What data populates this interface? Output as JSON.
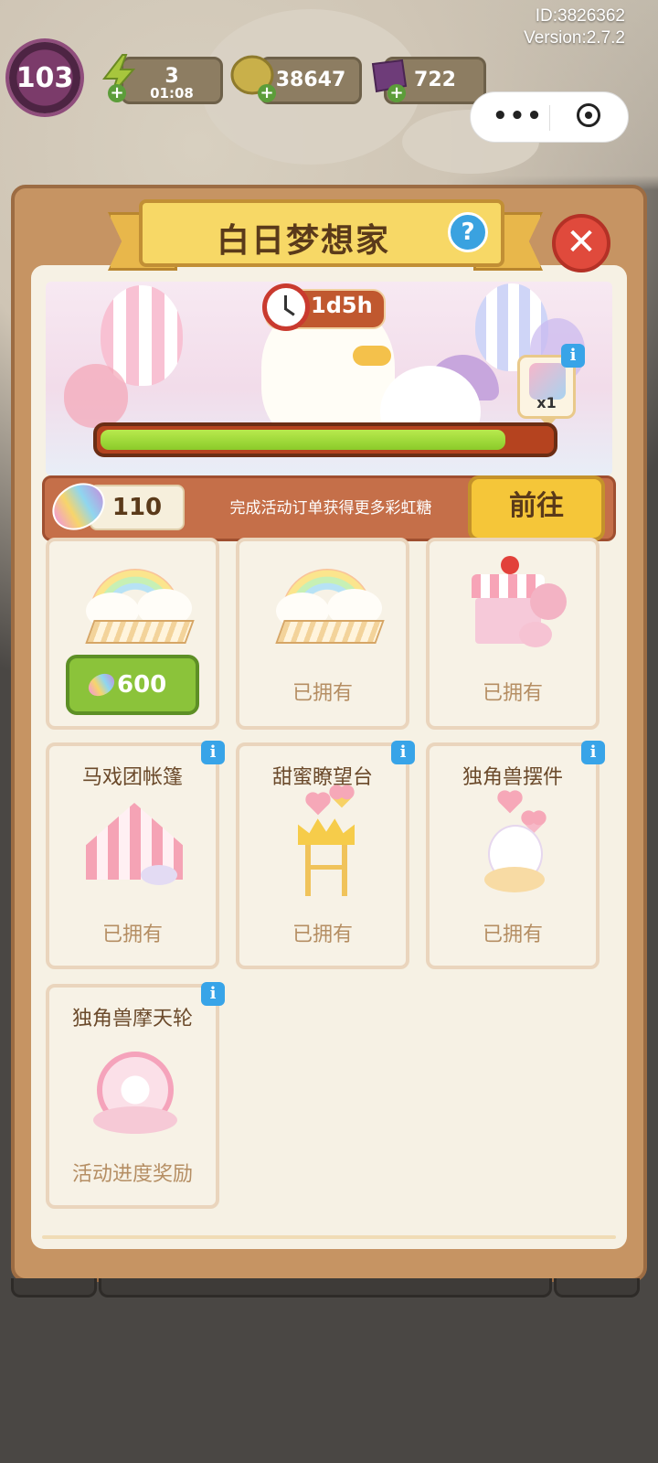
{
  "system": {
    "id_text": "ID:3826362",
    "version_text": "Version:2.7.2"
  },
  "top_bar": {
    "level": "103",
    "energy": {
      "value": "3",
      "timer": "01:08",
      "icon": "lightning-icon"
    },
    "coins": {
      "value": "38647",
      "icon": "coin-icon"
    },
    "gems": {
      "value": "722",
      "icon": "gem-icon"
    }
  },
  "capsule": {
    "more_icon": "more-dots-icon",
    "close_icon": "target-icon"
  },
  "dialog": {
    "title": "白日梦想家",
    "help_icon": "question-icon",
    "help_symbol": "?",
    "close_icon": "close-icon",
    "close_symbol": "✕",
    "timer": "1d5h",
    "reward_qty": "x1",
    "progress_fraction": 0.9,
    "candy_count": "110",
    "hint": "完成活动订单获得更多彩虹糖",
    "go_label": "前往",
    "info_symbol": "i"
  },
  "items": [
    {
      "title": "",
      "status": "",
      "price": "600",
      "has_info": false,
      "art": "cloud-rainbow-fence"
    },
    {
      "title": "",
      "status": "已拥有",
      "price": "",
      "has_info": false,
      "art": "cloud-rainbow-fence-2"
    },
    {
      "title": "",
      "status": "已拥有",
      "price": "",
      "has_info": false,
      "art": "dessert-shop"
    },
    {
      "title": "马戏团帐篷",
      "status": "已拥有",
      "price": "",
      "has_info": true,
      "art": "circus-tent"
    },
    {
      "title": "甜蜜瞭望台",
      "status": "已拥有",
      "price": "",
      "has_info": true,
      "art": "sweet-tower"
    },
    {
      "title": "独角兽摆件",
      "status": "已拥有",
      "price": "",
      "has_info": true,
      "art": "unicorn-ornament"
    },
    {
      "title": "独角兽摩天轮",
      "status": "活动进度奖励",
      "price": "",
      "has_info": true,
      "art": "unicorn-ferris-wheel"
    }
  ],
  "colors": {
    "panel": "#c69463",
    "ribbon": "#f7d866",
    "progress": "#8bcb2a",
    "button_green": "#8bc33a",
    "button_yellow": "#f5c639",
    "close_red": "#e04a3c",
    "info_blue": "#38a4e8"
  }
}
